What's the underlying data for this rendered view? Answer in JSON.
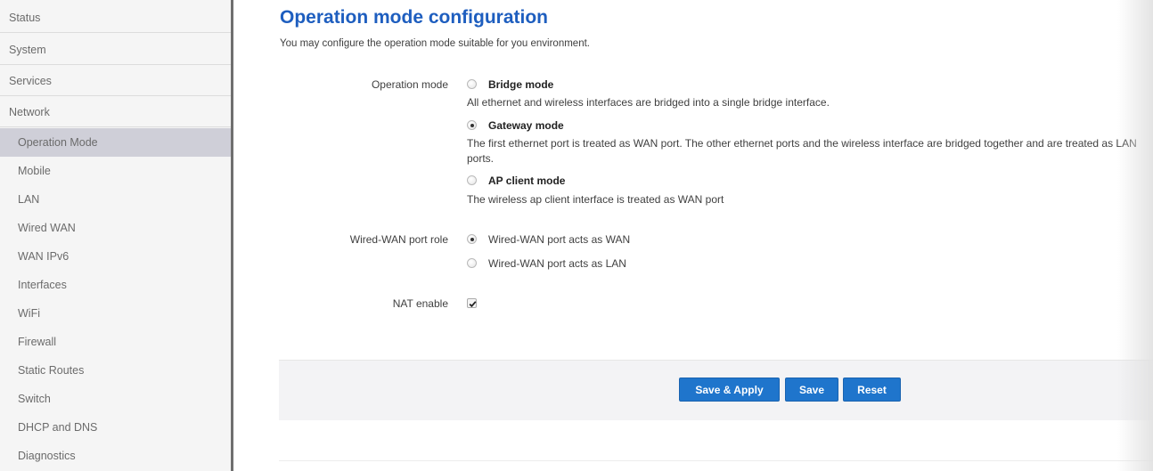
{
  "sidebar": {
    "top_items": [
      {
        "label": "Status"
      },
      {
        "label": "System"
      },
      {
        "label": "Services"
      },
      {
        "label": "Network"
      }
    ],
    "sub_items": [
      {
        "label": "Operation Mode",
        "active": true
      },
      {
        "label": "Mobile"
      },
      {
        "label": "LAN"
      },
      {
        "label": "Wired WAN"
      },
      {
        "label": "WAN IPv6"
      },
      {
        "label": "Interfaces"
      },
      {
        "label": "WiFi"
      },
      {
        "label": "Firewall"
      },
      {
        "label": "Static Routes"
      },
      {
        "label": "Switch"
      },
      {
        "label": "DHCP and DNS"
      },
      {
        "label": "Diagnostics"
      }
    ]
  },
  "main": {
    "title": "Operation mode configuration",
    "subtitle": "You may configure the operation mode suitable for you environment.",
    "operation_mode": {
      "label": "Operation mode",
      "options": [
        {
          "title": "Bridge mode",
          "desc": "All ethernet and wireless interfaces are bridged into a single bridge interface.",
          "checked": false
        },
        {
          "title": "Gateway mode",
          "desc": "The first ethernet port is treated as WAN port. The other ethernet ports and the wireless interface are bridged together and are treated as LAN ports.",
          "checked": true
        },
        {
          "title": "AP client mode",
          "desc": "The wireless ap client interface is treated as WAN port",
          "checked": false
        }
      ]
    },
    "wan_port_role": {
      "label": "Wired-WAN port role",
      "options": [
        {
          "label": "Wired-WAN port acts as WAN",
          "checked": true
        },
        {
          "label": "Wired-WAN port acts as LAN",
          "checked": false
        }
      ]
    },
    "nat": {
      "label": "NAT enable",
      "checked": true
    },
    "actions": {
      "save_apply": "Save & Apply",
      "save": "Save",
      "reset": "Reset"
    }
  },
  "colors": {
    "accent": "#1e5ebf",
    "button": "#1f75cc",
    "sidebar_active": "#cfcfd8"
  }
}
